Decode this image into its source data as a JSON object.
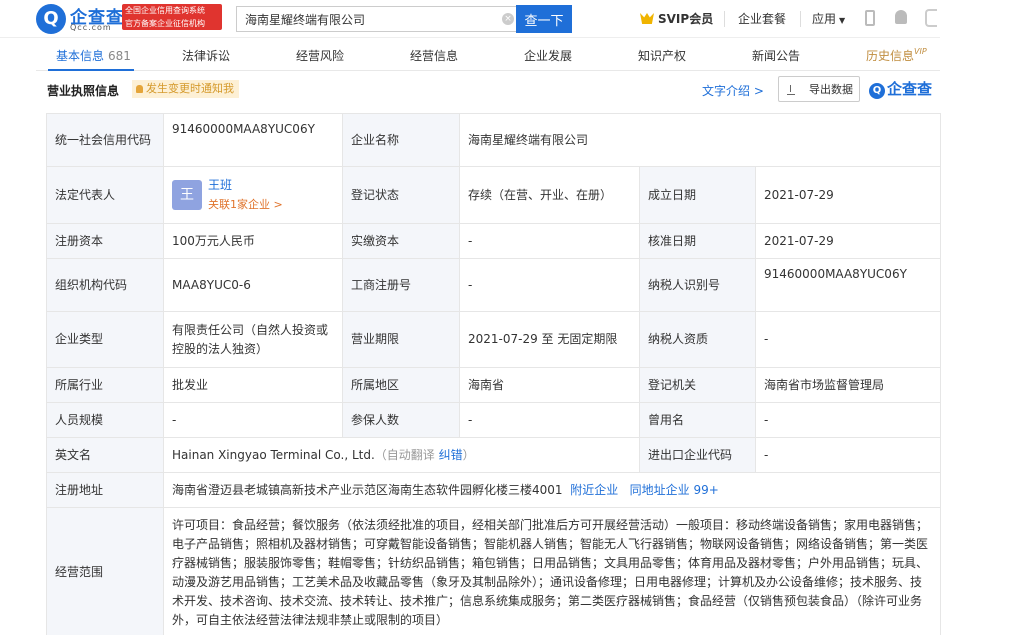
{
  "header": {
    "logo_glyph": "Q",
    "logo_title": "企查查",
    "logo_url": "Qcc.com",
    "logo_badge_line1": "全国企业信用查询系统",
    "logo_badge_line2": "官方备案企业征信机构",
    "search_value": "海南星耀终端有限公司",
    "search_button": "查一下",
    "svip_label": "SVIP会员",
    "enterprise_package": "企业套餐",
    "apps_label": "应用"
  },
  "tabs": [
    {
      "label": "基本信息",
      "count": "681"
    },
    {
      "label": "法律诉讼"
    },
    {
      "label": "经营风险"
    },
    {
      "label": "经营信息"
    },
    {
      "label": "企业发展"
    },
    {
      "label": "知识产权"
    },
    {
      "label": "新闻公告"
    },
    {
      "label": "历史信息",
      "badge": "VIP"
    }
  ],
  "section": {
    "title": "营业执照信息",
    "notify": "发生变更时通知我",
    "text_intro": "文字介绍 >",
    "export": "导出数据",
    "qcc_mark": "企查查"
  },
  "info": {
    "credit_code_label": "统一社会信用代码",
    "credit_code": "91460000MAA8YUC06Y",
    "company_name_label": "企业名称",
    "company_name": "海南星耀终端有限公司",
    "legal_rep_label": "法定代表人",
    "legal_rep_avatar": "王",
    "legal_rep_name": "王班",
    "legal_rep_link": "关联1家企业 >",
    "reg_status_label": "登记状态",
    "reg_status": "存续（在营、开业、在册）",
    "found_date_label": "成立日期",
    "found_date": "2021-07-29",
    "reg_capital_label": "注册资本",
    "reg_capital": "100万元人民币",
    "paid_capital_label": "实缴资本",
    "paid_capital": "-",
    "approve_date_label": "核准日期",
    "approve_date": "2021-07-29",
    "org_code_label": "组织机构代码",
    "org_code": "MAA8YUC0-6",
    "biz_reg_no_label": "工商注册号",
    "biz_reg_no": "-",
    "taxpayer_id_label": "纳税人识别号",
    "taxpayer_id": "91460000MAA8YUC06Y",
    "company_type_label": "企业类型",
    "company_type": "有限责任公司（自然人投资或控股的法人独资）",
    "biz_term_label": "营业期限",
    "biz_term": "2021-07-29 至 无固定期限",
    "taxpayer_qual_label": "纳税人资质",
    "taxpayer_qual": "-",
    "industry_label": "所属行业",
    "industry": "批发业",
    "region_label": "所属地区",
    "region": "海南省",
    "reg_authority_label": "登记机关",
    "reg_authority": "海南省市场监督管理局",
    "staff_size_label": "人员规模",
    "staff_size": "-",
    "insured_label": "参保人数",
    "insured": "-",
    "former_name_label": "曾用名",
    "former_name": "-",
    "english_name_label": "英文名",
    "english_name": "Hainan Xingyao Terminal Co., Ltd.",
    "english_auto": "（自动翻译",
    "english_fix": "纠错",
    "english_close": "）",
    "import_export_label": "进出口企业代码",
    "import_export": "-",
    "address_label": "注册地址",
    "address": "海南省澄迈县老城镇高新技术产业示范区海南生态软件园孵化楼三楼4001",
    "nearby_link": "附近企业",
    "same_address_link": "同地址企业 99+",
    "scope_label": "经营范围",
    "scope": "许可项目：食品经营；餐饮服务（依法须经批准的项目，经相关部门批准后方可开展经营活动）一般项目：移动终端设备销售；家用电器销售；电子产品销售；照相机及器材销售；可穿戴智能设备销售；智能机器人销售；智能无人飞行器销售；物联网设备销售；网络设备销售；第一类医疗器械销售；服装服饰零售；鞋帽零售；针纺织品销售；箱包销售；日用品销售；文具用品零售；体育用品及器材零售；户外用品销售；玩具、动漫及游艺用品销售；工艺美术品及收藏品零售（象牙及其制品除外）；通讯设备修理；日用电器修理；计算机及办公设备维修；技术服务、技术开发、技术咨询、技术交流、技术转让、技术推广；信息系统集成服务；第二类医疗器械销售；食品经营（仅销售预包装食品）（除许可业务外，可自主依法经营法律法规非禁止或限制的项目）"
  }
}
